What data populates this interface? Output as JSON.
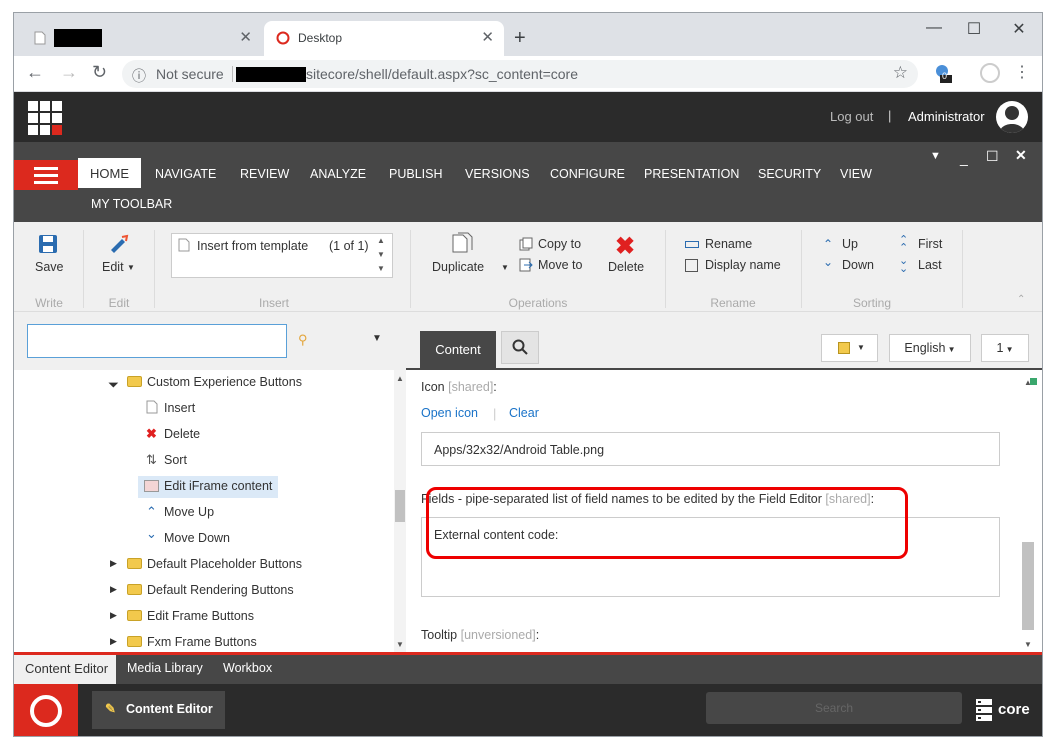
{
  "browser": {
    "tabs": [
      {
        "title": "",
        "close": "✕"
      },
      {
        "title": "Desktop",
        "close": "✕"
      }
    ],
    "new_tab": "+",
    "window_controls": {
      "minimize": "—",
      "maximize": "☐",
      "close": "✕"
    },
    "security_label": "Not secure",
    "url": "sitecore/shell/default.aspx?sc_content=core",
    "extension_badge": "0"
  },
  "header": {
    "logout": "Log out",
    "separator": "|",
    "user": "Administrator"
  },
  "ribbon_tabs": [
    "HOME",
    "NAVIGATE",
    "REVIEW",
    "ANALYZE",
    "PUBLISH",
    "VERSIONS",
    "CONFIGURE",
    "PRESENTATION",
    "SECURITY",
    "VIEW"
  ],
  "ribbon_tab_row2": "MY TOOLBAR",
  "ribbon": {
    "save": "Save",
    "edit": "Edit",
    "insert_from_template": "Insert from template",
    "insert_count": "(1 of 1)",
    "duplicate": "Duplicate",
    "copy_to": "Copy to",
    "move_to": "Move to",
    "delete": "Delete",
    "rename": "Rename",
    "display_name": "Display name",
    "up": "Up",
    "down": "Down",
    "first": "First",
    "last": "Last",
    "groups": {
      "write": "Write",
      "edit": "Edit",
      "insert": "Insert",
      "operations": "Operations",
      "rename": "Rename",
      "sorting": "Sorting"
    }
  },
  "tree": {
    "items": [
      {
        "label": "Custom Experience Buttons",
        "icon": "folder-icon",
        "expanded": true
      },
      {
        "label": "Insert",
        "icon": "page-icon"
      },
      {
        "label": "Delete",
        "icon": "delete-icon"
      },
      {
        "label": "Sort",
        "icon": "sort-icon"
      },
      {
        "label": "Edit iFrame content",
        "icon": "iframe-icon",
        "selected": true
      },
      {
        "label": "Move Up",
        "icon": "chevron-up-icon"
      },
      {
        "label": "Move Down",
        "icon": "chevron-down-icon"
      },
      {
        "label": "Default Placeholder Buttons",
        "icon": "folder-icon"
      },
      {
        "label": "Default Rendering Buttons",
        "icon": "folder-icon"
      },
      {
        "label": "Edit Frame Buttons",
        "icon": "folder-icon"
      },
      {
        "label": "Fxm Frame Buttons",
        "icon": "folder-icon"
      }
    ]
  },
  "editor": {
    "tab_content": "Content",
    "language": "English",
    "version": "1",
    "icon_label": "Icon",
    "icon_shared": "[shared]",
    "open_icon": "Open icon",
    "clear": "Clear",
    "icon_value": "Apps/32x32/Android Table.png",
    "fields_label": "Fields - pipe-separated list of field names to be edited by the Field Editor",
    "fields_shared": "[shared]",
    "fields_value": "External content code:",
    "tooltip_label": "Tooltip",
    "tooltip_shared": "[unversioned]"
  },
  "bottom_tabs": [
    "Content Editor",
    "Media Library",
    "Workbox"
  ],
  "taskbar": {
    "app": "Content Editor",
    "search_placeholder": "Search",
    "database": "core"
  },
  "colors": {
    "sitecore_red": "#dc291e",
    "dark_header": "#2b2b2b",
    "ribbon_dark": "#474747",
    "highlight": "#ee0000",
    "link": "#1a73c8"
  }
}
